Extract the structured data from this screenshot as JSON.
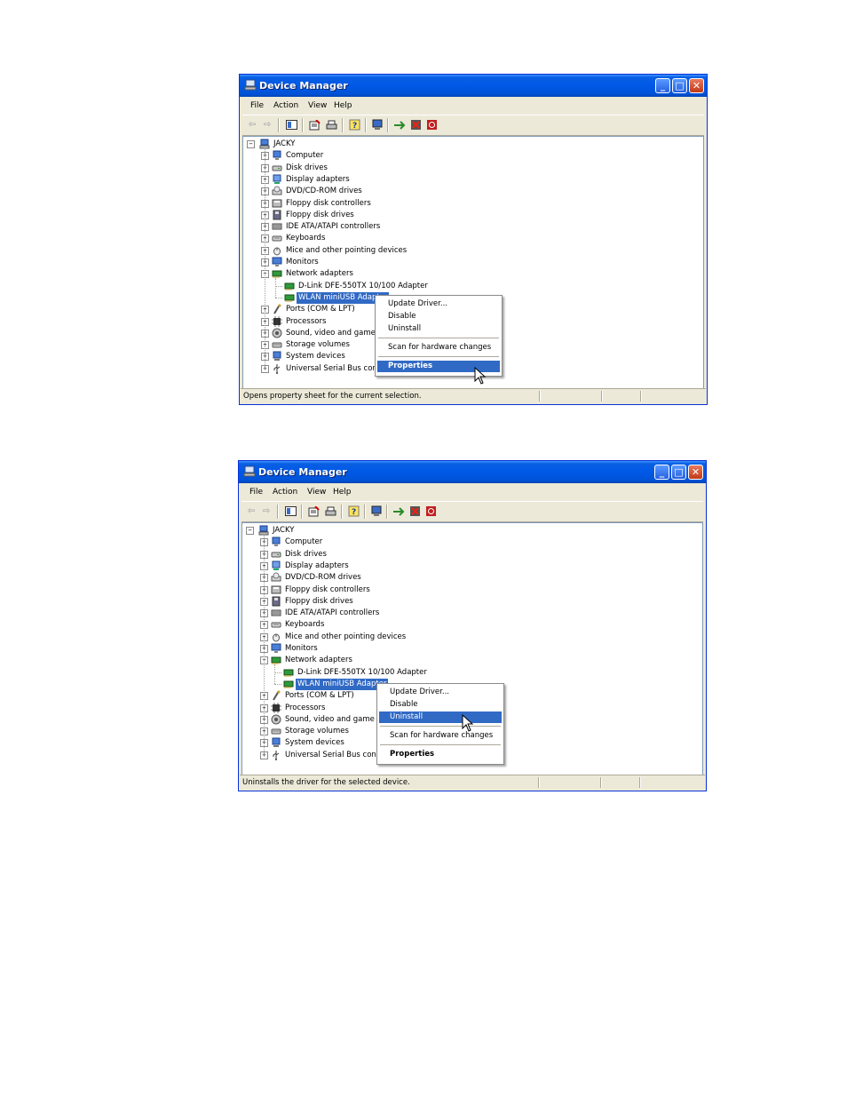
{
  "windows": [
    {
      "title": "Device Manager",
      "menu": [
        "File",
        "Action",
        "View",
        "Help"
      ],
      "tree": {
        "root": "JACKY",
        "items": [
          {
            "label": "Computer",
            "icon": "computer-icon"
          },
          {
            "label": "Disk drives",
            "icon": "disk-drive-icon"
          },
          {
            "label": "Display adapters",
            "icon": "display-adapter-icon"
          },
          {
            "label": "DVD/CD-ROM drives",
            "icon": "cdrom-icon"
          },
          {
            "label": "Floppy disk controllers",
            "icon": "floppy-controller-icon"
          },
          {
            "label": "Floppy disk drives",
            "icon": "floppy-drive-icon"
          },
          {
            "label": "IDE ATA/ATAPI controllers",
            "icon": "ide-controller-icon"
          },
          {
            "label": "Keyboards",
            "icon": "keyboard-icon"
          },
          {
            "label": "Mice and other pointing devices",
            "icon": "mouse-icon"
          },
          {
            "label": "Monitors",
            "icon": "monitor-icon"
          },
          {
            "label": "Network adapters",
            "icon": "network-adapter-icon",
            "expanded": true,
            "children": [
              "D-Link DFE-550TX 10/100 Adapter",
              "WLAN miniUSB Adapter"
            ]
          },
          {
            "label": "Ports (COM & LPT)",
            "icon": "port-icon"
          },
          {
            "label": "Processors",
            "icon": "processor-icon"
          },
          {
            "label": "Sound, video and game c",
            "icon": "sound-icon"
          },
          {
            "label": "Storage volumes",
            "icon": "storage-icon"
          },
          {
            "label": "System devices",
            "icon": "system-device-icon"
          },
          {
            "label": "Universal Serial Bus contr",
            "icon": "usb-icon"
          }
        ]
      },
      "context_menu": {
        "items": [
          "Update Driver...",
          "Disable",
          "Uninstall",
          "Scan for hardware changes",
          "Properties"
        ],
        "highlighted": "Properties"
      },
      "status": "Opens property sheet for the current selection."
    },
    {
      "title": "Device Manager",
      "menu": [
        "File",
        "Action",
        "View",
        "Help"
      ],
      "tree": {
        "root": "JACKY",
        "items": [
          {
            "label": "Computer",
            "icon": "computer-icon"
          },
          {
            "label": "Disk drives",
            "icon": "disk-drive-icon"
          },
          {
            "label": "Display adapters",
            "icon": "display-adapter-icon"
          },
          {
            "label": "DVD/CD-ROM drives",
            "icon": "cdrom-icon"
          },
          {
            "label": "Floppy disk controllers",
            "icon": "floppy-controller-icon"
          },
          {
            "label": "Floppy disk drives",
            "icon": "floppy-drive-icon"
          },
          {
            "label": "IDE ATA/ATAPI controllers",
            "icon": "ide-controller-icon"
          },
          {
            "label": "Keyboards",
            "icon": "keyboard-icon"
          },
          {
            "label": "Mice and other pointing devices",
            "icon": "mouse-icon"
          },
          {
            "label": "Monitors",
            "icon": "monitor-icon"
          },
          {
            "label": "Network adapters",
            "icon": "network-adapter-icon",
            "expanded": true,
            "children": [
              "D-Link DFE-550TX 10/100 Adapter",
              "WLAN miniUSB Adapter"
            ]
          },
          {
            "label": "Ports (COM & LPT)",
            "icon": "port-icon"
          },
          {
            "label": "Processors",
            "icon": "processor-icon"
          },
          {
            "label": "Sound, video and game c",
            "icon": "sound-icon"
          },
          {
            "label": "Storage volumes",
            "icon": "storage-icon"
          },
          {
            "label": "System devices",
            "icon": "system-device-icon"
          },
          {
            "label": "Universal Serial Bus contr",
            "icon": "usb-icon"
          }
        ]
      },
      "context_menu": {
        "items": [
          "Update Driver...",
          "Disable",
          "Uninstall",
          "Scan for hardware changes",
          "Properties"
        ],
        "highlighted": "Uninstall"
      },
      "status": "Uninstalls the driver for the selected device."
    }
  ],
  "colors": {
    "selection": "#316ac5",
    "title_bar": "#0058e6",
    "window_face": "#ece9d8"
  }
}
